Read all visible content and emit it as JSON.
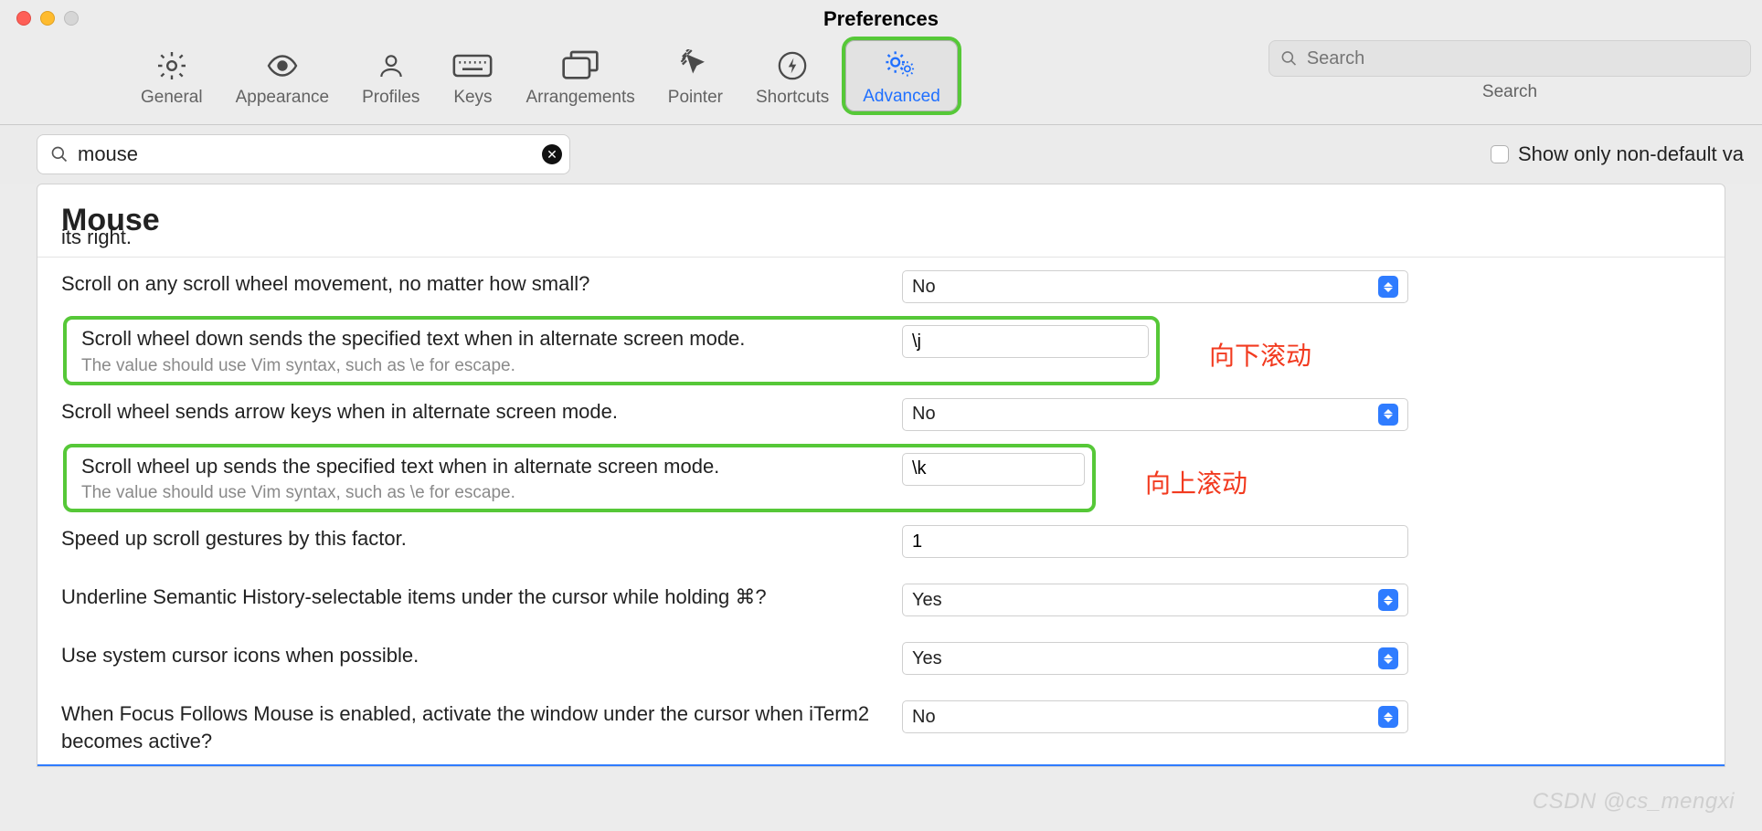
{
  "window": {
    "title": "Preferences"
  },
  "toolbar": {
    "tabs": [
      {
        "id": "general",
        "label": "General"
      },
      {
        "id": "appearance",
        "label": "Appearance"
      },
      {
        "id": "profiles",
        "label": "Profiles"
      },
      {
        "id": "keys",
        "label": "Keys"
      },
      {
        "id": "arrangements",
        "label": "Arrangements"
      },
      {
        "id": "pointer",
        "label": "Pointer"
      },
      {
        "id": "shortcuts",
        "label": "Shortcuts"
      },
      {
        "id": "advanced",
        "label": "Advanced",
        "selected": true
      }
    ],
    "search": {
      "placeholder": "Search",
      "label": "Search"
    }
  },
  "filter": {
    "value": "mouse",
    "non_default_label": "Show only non-default va",
    "non_default_checked": false
  },
  "section": {
    "title": "Mouse",
    "truncated_prev": "its right."
  },
  "rows": [
    {
      "label": "Scroll on any scroll wheel movement, no matter how small?",
      "type": "select",
      "value": "No"
    },
    {
      "label": "Scroll wheel down sends the specified text when in alternate screen mode.",
      "hint": "The value should use Vim syntax, such as \\e for escape.",
      "type": "text",
      "value": "\\j",
      "highlight": true,
      "annotation": "向下滚动"
    },
    {
      "label": "Scroll wheel sends arrow keys when in alternate screen mode.",
      "type": "select",
      "value": "No"
    },
    {
      "label": "Scroll wheel up sends the specified text when in alternate screen mode.",
      "hint": "The value should use Vim syntax, such as \\e for escape.",
      "type": "text",
      "value": "\\k",
      "highlight": true,
      "annotation": "向上滚动",
      "narrow": 2
    },
    {
      "label": "Speed up scroll gestures by this factor.",
      "type": "text",
      "value": "1"
    },
    {
      "label": "Underline Semantic History-selectable items under the cursor while holding ⌘?",
      "type": "select",
      "value": "Yes"
    },
    {
      "label": "Use system cursor icons when possible.",
      "type": "select",
      "value": "Yes"
    },
    {
      "label": "When Focus Follows Mouse is enabled, activate the window under the cursor when iTerm2 becomes active?",
      "type": "select",
      "value": "No"
    }
  ],
  "watermark": "CSDN @cs_mengxi"
}
